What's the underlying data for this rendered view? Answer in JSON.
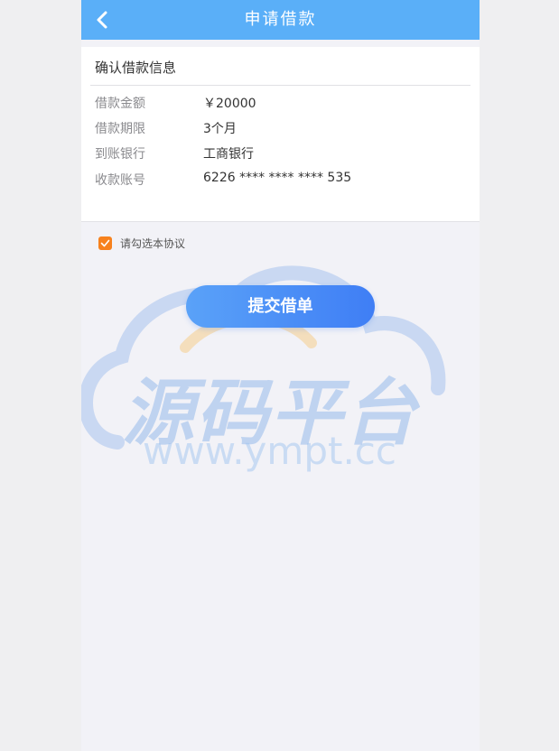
{
  "header": {
    "title": "申请借款"
  },
  "card": {
    "title": "确认借款信息",
    "rows": [
      {
        "label": "借款金额",
        "value": "￥20000"
      },
      {
        "label": "借款期限",
        "value": "3个月"
      },
      {
        "label": "到账银行",
        "value": "工商银行"
      },
      {
        "label": "收款账号",
        "value": "6226 **** **** **** 535"
      }
    ]
  },
  "agreement": {
    "label": "请勾选本协议",
    "checked": true
  },
  "submit": {
    "label": "提交借单"
  },
  "watermark": {
    "text": "源码平台",
    "url": "www.ympt.cc"
  },
  "colors": {
    "header": "#5aaff8",
    "checkbox": "#f7811d",
    "button_start": "#5aa2f8",
    "button_end": "#3f7ef5"
  }
}
